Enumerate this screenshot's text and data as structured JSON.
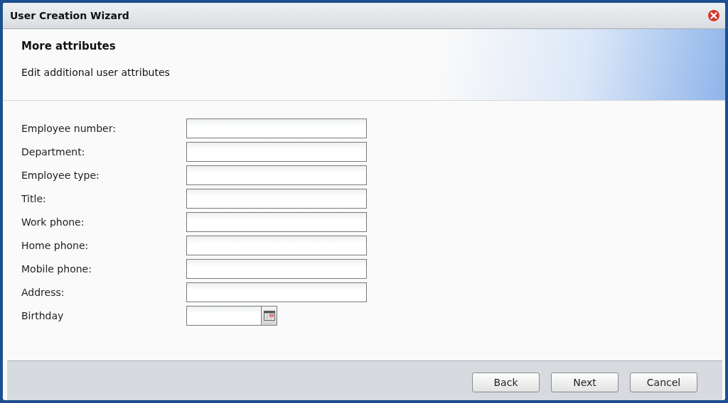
{
  "window": {
    "title": "User Creation Wizard"
  },
  "header": {
    "title": "More attributes",
    "subtitle": "Edit additional user attributes"
  },
  "fields": [
    {
      "label": "Employee number:",
      "kind": "text"
    },
    {
      "label": "Department:",
      "kind": "text"
    },
    {
      "label": "Employee type:",
      "kind": "text"
    },
    {
      "label": "Title:",
      "kind": "text"
    },
    {
      "label": "Work phone:",
      "kind": "text"
    },
    {
      "label": "Home phone:",
      "kind": "text"
    },
    {
      "label": "Mobile phone:",
      "kind": "text"
    },
    {
      "label": "Address:",
      "kind": "text"
    },
    {
      "label": "Birthday",
      "kind": "date"
    }
  ],
  "buttons": [
    "Back",
    "Next",
    "Cancel"
  ]
}
